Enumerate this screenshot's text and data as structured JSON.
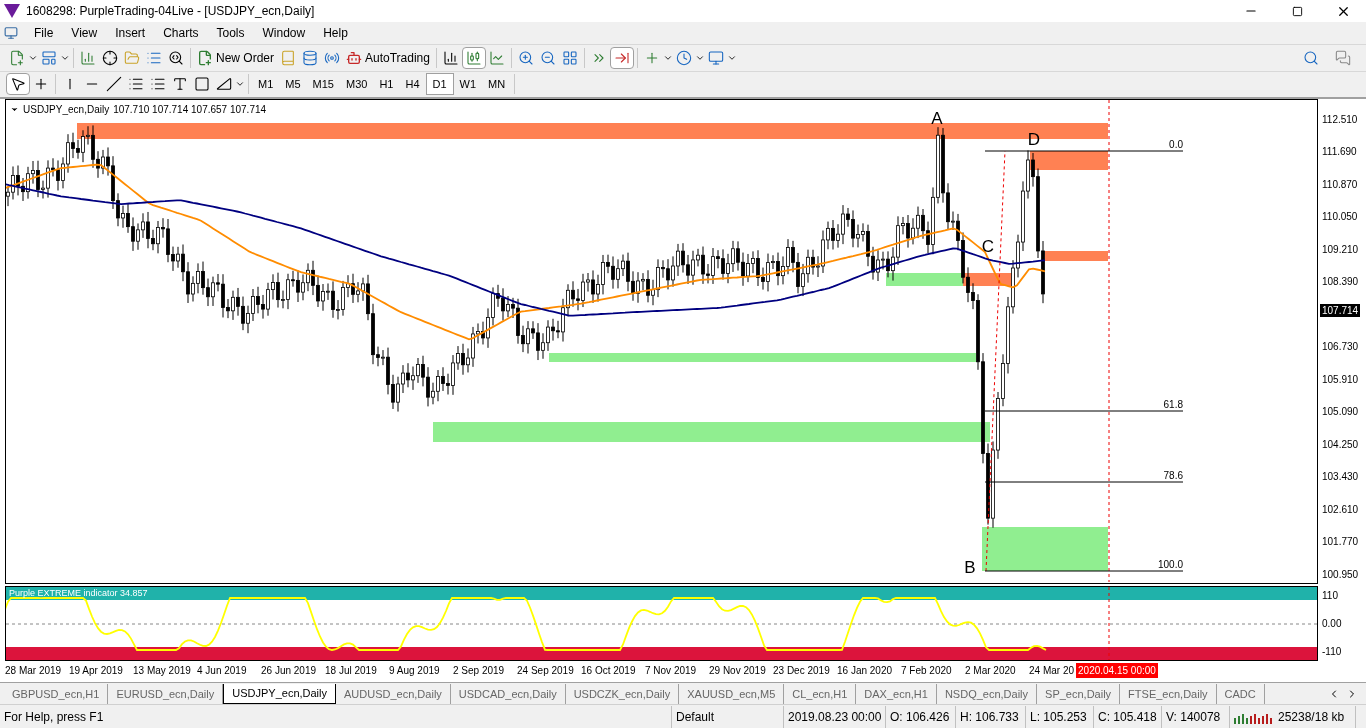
{
  "window": {
    "title": "1608298: PurpleTrading-04Live - [USDJPY_ecn,Daily]"
  },
  "menu": [
    "File",
    "View",
    "Insert",
    "Charts",
    "Tools",
    "Window",
    "Help"
  ],
  "toolbar": {
    "new_order": "New Order",
    "auto_trading": "AutoTrading"
  },
  "timeframes": [
    {
      "label": "M1",
      "selected": false
    },
    {
      "label": "M5",
      "selected": false
    },
    {
      "label": "M15",
      "selected": false
    },
    {
      "label": "M30",
      "selected": false
    },
    {
      "label": "H1",
      "selected": false
    },
    {
      "label": "H4",
      "selected": false
    },
    {
      "label": "D1",
      "selected": true
    },
    {
      "label": "W1",
      "selected": false
    },
    {
      "label": "MN",
      "selected": false
    }
  ],
  "chart": {
    "symbol": "USDJPY_ecn,Daily",
    "ohlc": "107.710 107.714 107.657 107.714",
    "wave_labels": [
      "A",
      "B",
      "C",
      "D"
    ],
    "fib_levels": [
      "0.0",
      "61.8",
      "78.6",
      "100.0"
    ],
    "price_axis": [
      "112.510",
      "111.690",
      "110.870",
      "110.050",
      "109.210",
      "108.390",
      "106.730",
      "105.910",
      "105.090",
      "104.250",
      "103.430",
      "102.610",
      "101.770",
      "100.950"
    ],
    "current_price": "107.714"
  },
  "indicator": {
    "label": "Purple EXTREME indicator 34.857",
    "axis": [
      "110",
      "0.00",
      "-110"
    ]
  },
  "time_axis": {
    "labels": [
      "28 Mar 2019",
      "19 Apr 2019",
      "13 May 2019",
      "4 Jun 2019",
      "26 Jun 2019",
      "18 Jul 2019",
      "9 Aug 2019",
      "2 Sep 2019",
      "24 Sep 2019",
      "16 Oct 2019",
      "7 Nov 2019",
      "29 Nov 2019",
      "23 Dec 2019",
      "16 Jan 2020",
      "7 Feb 2020",
      "2 Mar 2020",
      "24 Mar 20"
    ],
    "cursor_time": "2020.04.15 00:00"
  },
  "tabs": [
    {
      "label": "GBPUSD_ecn,H1",
      "selected": false
    },
    {
      "label": "EURUSD_ecn,Daily",
      "selected": false
    },
    {
      "label": "USDJPY_ecn,Daily",
      "selected": true
    },
    {
      "label": "AUDUSD_ecn,Daily",
      "selected": false
    },
    {
      "label": "USDCAD_ecn,Daily",
      "selected": false
    },
    {
      "label": "USDCZK_ecn,Daily",
      "selected": false
    },
    {
      "label": "XAUUSD_ecn,M5",
      "selected": false
    },
    {
      "label": "CL_ecn,H1",
      "selected": false
    },
    {
      "label": "DAX_ecn,H1",
      "selected": false
    },
    {
      "label": "NSDQ_ecn,Daily",
      "selected": false
    },
    {
      "label": "SP_ecn,Daily",
      "selected": false
    },
    {
      "label": "FTSE_ecn,Daily",
      "selected": false
    },
    {
      "label": "CADC",
      "selected": false
    }
  ],
  "status_bar": [
    "For Help, press F1",
    "Default",
    "2019.08.23 00:00",
    "O: 106.426",
    "H: 106.733",
    "L: 105.253",
    "C: 105.418",
    "V: 140078",
    "25238/18 kb"
  ]
}
